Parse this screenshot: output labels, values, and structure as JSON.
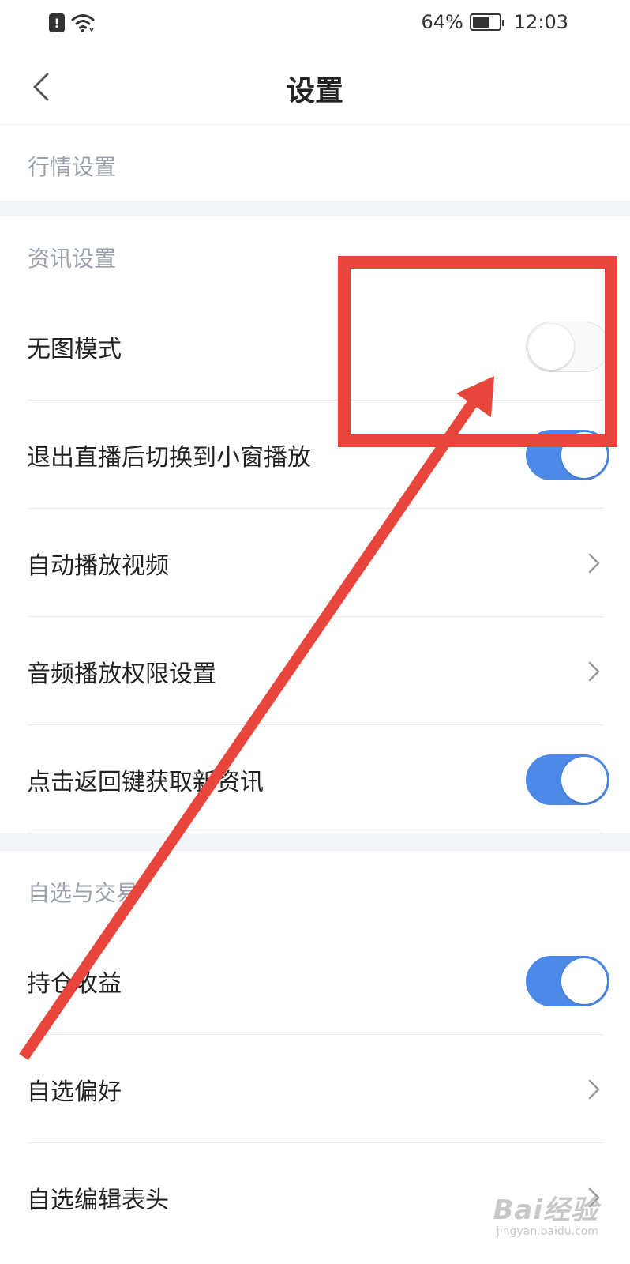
{
  "status_bar": {
    "battery_percent": "64%",
    "battery_level": 0.64,
    "time": "12:03",
    "icons": [
      "alert-icon",
      "wifi-icon",
      "battery-icon"
    ]
  },
  "nav": {
    "title": "设置",
    "back_icon": "chevron-left-icon"
  },
  "sections": [
    {
      "header": "行情设置",
      "rows": []
    },
    {
      "header": "资讯设置",
      "rows": [
        {
          "label": "无图模式",
          "control": "toggle",
          "state": "off"
        },
        {
          "label": "退出直播后切换到小窗播放",
          "control": "toggle",
          "state": "on"
        },
        {
          "label": "自动播放视频",
          "control": "chevron"
        },
        {
          "label": "音频播放权限设置",
          "control": "chevron"
        },
        {
          "label": "点击返回键获取新资讯",
          "control": "toggle",
          "state": "on"
        }
      ]
    },
    {
      "header": "自选与交易",
      "rows": [
        {
          "label": "持仓收益",
          "control": "toggle",
          "state": "on"
        },
        {
          "label": "自选偏好",
          "control": "chevron"
        },
        {
          "label": "自选编辑表头",
          "control": "chevron"
        }
      ]
    }
  ],
  "annotation": {
    "color": "#e8453c",
    "shapes": [
      "highlight-rectangle",
      "arrow"
    ]
  },
  "watermark": {
    "brand": "Bai经验",
    "url": "jingyan.baidu.com"
  },
  "colors": {
    "toggle_on": "#4d8ae8",
    "section_gap": "#f4f5f8",
    "section_header_text": "#9aa0aa"
  }
}
